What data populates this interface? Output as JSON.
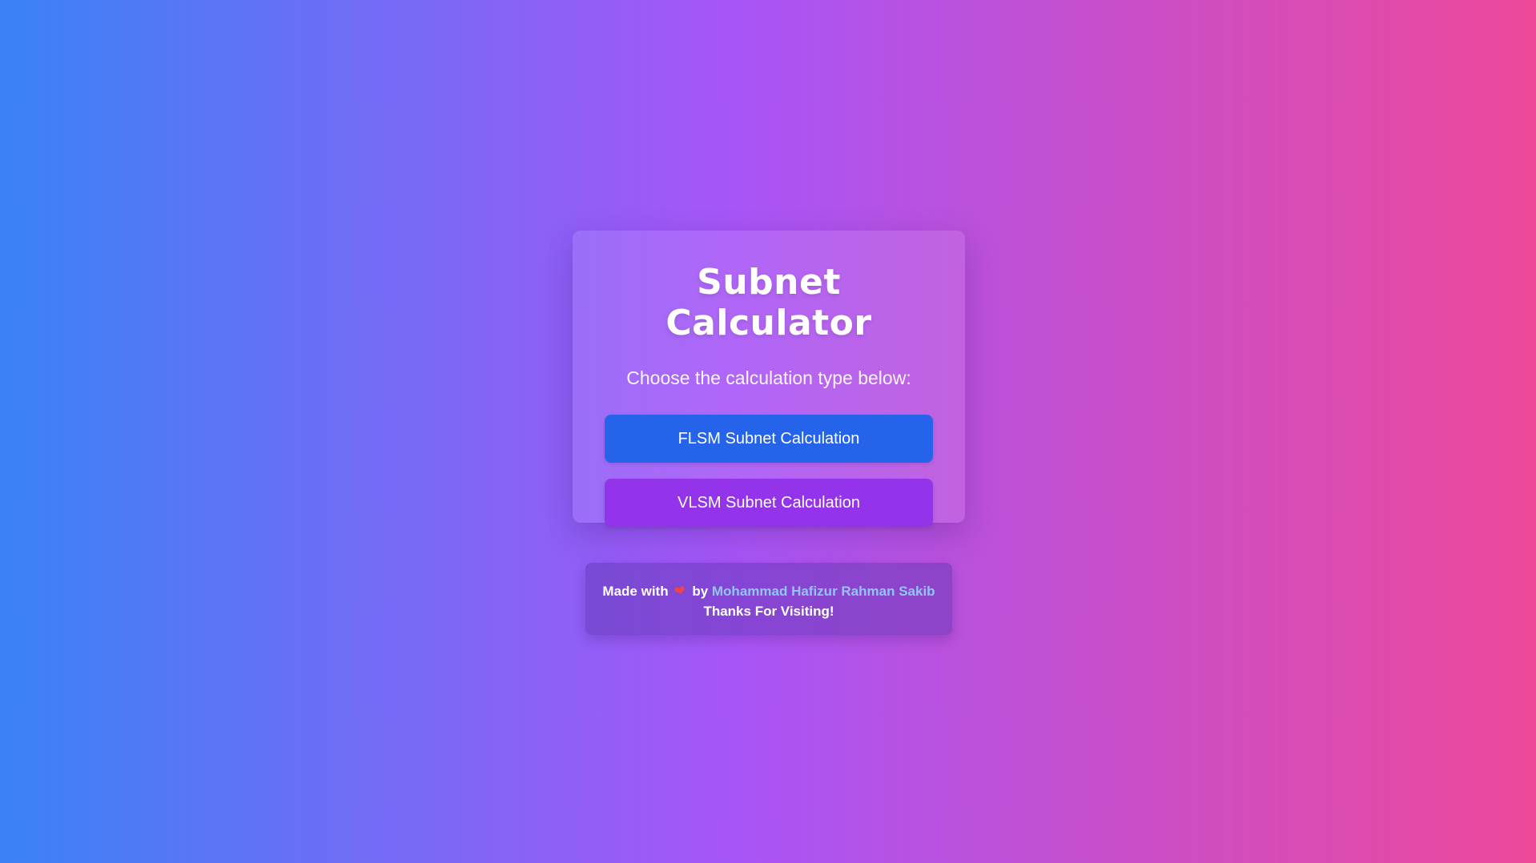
{
  "card": {
    "title": "Subnet Calculator",
    "subtitle": "Choose the calculation type below:",
    "buttons": {
      "flsm": "FLSM Subnet Calculation",
      "vlsm": "VLSM Subnet Calculation"
    }
  },
  "footer": {
    "made_with": "Made with",
    "heart_icon": "❤",
    "by": "by",
    "author": "Mohammad Hafizur Rahman Sakib",
    "thanks": "Thanks For Visiting!"
  },
  "colors": {
    "gradient_start": "#3b82f6",
    "gradient_mid": "#a855f7",
    "gradient_end": "#ec4899",
    "flsm_button": "#2563eb",
    "vlsm_button": "#9333ea",
    "author_link": "#93c5fd",
    "heart": "#ef4444"
  }
}
